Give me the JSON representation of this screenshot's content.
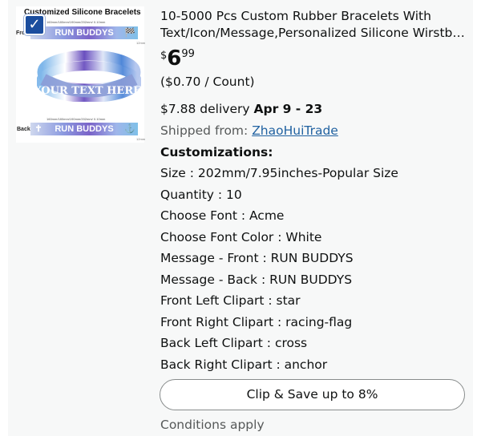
{
  "product_image": {
    "title": "Customized Silicone Bracelets",
    "strip_caption": "160mm/180mm/190mm/202mm/ 0.10mm",
    "front_label": "Front",
    "back_label": "Back",
    "front_text": "RUN BUDDYS",
    "back_text": "RUN BUDDYS",
    "band_text": "YOUR TEXT HERE",
    "mm_label": "12mm",
    "front_right_clipart": "🏁",
    "back_left_clipart": "✝",
    "back_right_clipart": "⚓",
    "checkbox_icon": "check-icon",
    "checked_glyph": "✓"
  },
  "product": {
    "title_line1": "10-5000 Pcs Custom Rubber Bracelets With",
    "title_line2": "Text/Icon/Message,Personalized Silicone Wirstba...",
    "price_symbol": "$",
    "price_whole": "6",
    "price_fraction": "99",
    "unit_price": "($0.70 / Count)",
    "delivery_cost": "$7.88 delivery",
    "delivery_dates": "Apr 9 - 23",
    "shipped_from_label": "Shipped from:",
    "seller": "ZhaoHuiTrade",
    "customizations_heading": "Customizations:",
    "customizations": [
      "Size : 202mm/7.95inches-Popular Size",
      "Quantity : 10",
      "Choose Font : Acme",
      "Choose Font Color : White",
      "Message - Front : RUN BUDDYS",
      "Message - Back : RUN BUDDYS",
      "Front Left Clipart : star",
      "Front Right Clipart : racing-flag",
      "Back Left Clipart : cross",
      "Back Right Clipart : anchor"
    ],
    "clip_button_label": "Clip & Save up to 8%",
    "conditions": "Conditions apply"
  },
  "colors": {
    "link": "#2162a1",
    "checkbox": "#1a4d9e",
    "text": "#0f1111",
    "muted": "#565959"
  }
}
